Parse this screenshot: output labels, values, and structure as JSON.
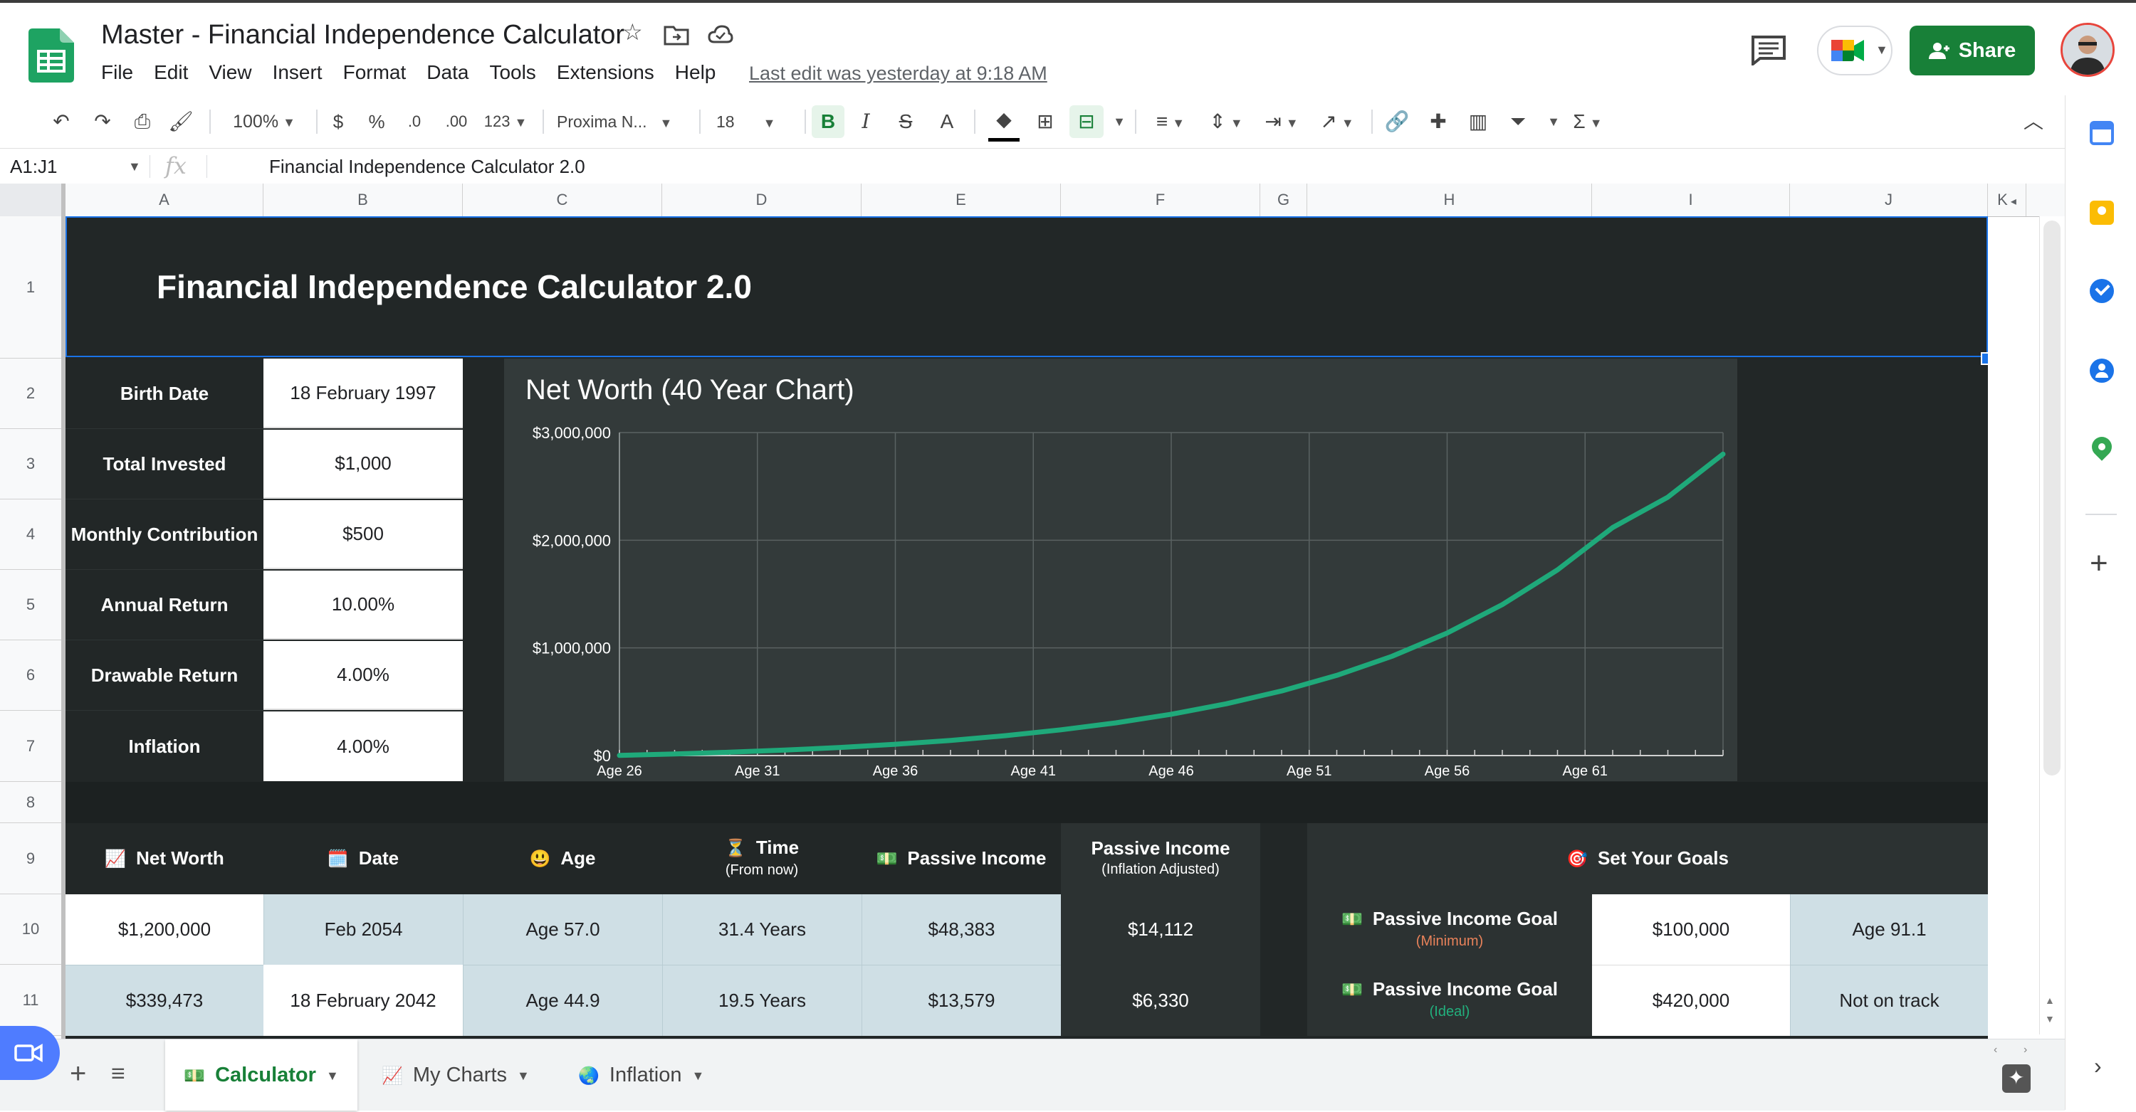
{
  "app": {
    "title": "Master - Financial Independence Calculator",
    "menu": [
      "File",
      "Edit",
      "View",
      "Insert",
      "Format",
      "Data",
      "Tools",
      "Extensions",
      "Help"
    ],
    "last_edit": "Last edit was yesterday at 9:18 AM",
    "share_label": "Share"
  },
  "toolbar": {
    "zoom": "100%",
    "currency": "$",
    "percent": "%",
    "dec_decrease": ".0",
    "dec_increase": ".00",
    "more_formats": "123",
    "font": "Proxima N...",
    "font_size": "18",
    "bold": "B",
    "italic": "I",
    "strike": "S",
    "text_color": "A"
  },
  "formula_bar": {
    "name_box": "A1:J1",
    "fx": "fx",
    "content": "Financial Independence Calculator 2.0"
  },
  "columns": [
    "A",
    "B",
    "C",
    "D",
    "E",
    "F",
    "G",
    "H",
    "I",
    "J",
    "K"
  ],
  "rows": [
    "1",
    "2",
    "3",
    "4",
    "5",
    "6",
    "7",
    "8",
    "9",
    "10",
    "11"
  ],
  "sheet": {
    "title": "Financial Independence Calculator 2.0",
    "inputs": [
      {
        "label": "Birth Date",
        "value": "18 February 1997"
      },
      {
        "label": "Total Invested",
        "value": "$1,000"
      },
      {
        "label": "Monthly Contribution",
        "value": "$500"
      },
      {
        "label": "Annual Return",
        "value": "10.00%"
      },
      {
        "label": "Drawable Return",
        "value": "4.00%"
      },
      {
        "label": "Inflation",
        "value": "4.00%"
      }
    ],
    "table_headers": [
      {
        "icon": "📈",
        "label": "Net Worth",
        "sub": ""
      },
      {
        "icon": "🗓️",
        "label": "Date",
        "sub": ""
      },
      {
        "icon": "😃",
        "label": "Age",
        "sub": ""
      },
      {
        "icon": "⏳",
        "label": "Time",
        "sub": "(From now)"
      },
      {
        "icon": "💵",
        "label": "Passive Income",
        "sub": ""
      },
      {
        "icon": "",
        "label": "Passive Income",
        "sub": "(Inflation Adjusted)"
      }
    ],
    "table_rows": [
      [
        "$1,200,000",
        "Feb 2054",
        "Age 57.0",
        "31.4 Years",
        "$48,383",
        "$14,112"
      ],
      [
        "$339,473",
        "18 February 2042",
        "Age 44.9",
        "19.5 Years",
        "$13,579",
        "$6,330"
      ]
    ],
    "goals": {
      "header_icon": "🎯",
      "header": "Set Your Goals",
      "items": [
        {
          "icon": "💵",
          "label": "Passive Income Goal",
          "sub": "(Minimum)",
          "sub_color": "#e8825a",
          "amount": "$100,000",
          "status": "Age 91.1"
        },
        {
          "icon": "💵",
          "label": "Passive Income Goal",
          "sub": "(Ideal)",
          "sub_color": "#22b07d",
          "amount": "$420,000",
          "status": "Not on track"
        }
      ]
    }
  },
  "chart_data": {
    "type": "line",
    "title": "Net Worth (40 Year Chart)",
    "x_tick_labels": [
      "Age 26",
      "Age 31",
      "Age 36",
      "Age 41",
      "Age 46",
      "Age 51",
      "Age 56",
      "Age 61"
    ],
    "y_tick_labels": [
      "$0",
      "$1,000,000",
      "$2,000,000",
      "$3,000,000"
    ],
    "ylim": [
      0,
      3000000
    ],
    "xlim": [
      26,
      66
    ],
    "series": [
      {
        "color": "#1fa97a",
        "x": [
          26,
          28,
          30,
          32,
          34,
          36,
          38,
          40,
          42,
          44,
          46,
          48,
          50,
          52,
          54,
          56,
          58,
          60,
          62,
          64,
          66
        ],
        "y": [
          1000,
          14500,
          31000,
          51000,
          75000,
          105000,
          141000,
          185000,
          239000,
          304000,
          384000,
          481000,
          600000,
          745000,
          922000,
          1138000,
          1402000,
          1725000,
          2118000,
          2400000,
          2800000
        ]
      }
    ],
    "grid": true,
    "legend": "none"
  },
  "tabs": [
    {
      "icon": "💵",
      "label": "Calculator"
    },
    {
      "icon": "📈",
      "label": "My Charts"
    },
    {
      "icon": "🌏",
      "label": "Inflation"
    }
  ],
  "colors": {
    "dark_cell": "#222727",
    "chart_bg": "#333a3a",
    "light_blue": "#cfdfe5",
    "accent_green": "#188038"
  }
}
